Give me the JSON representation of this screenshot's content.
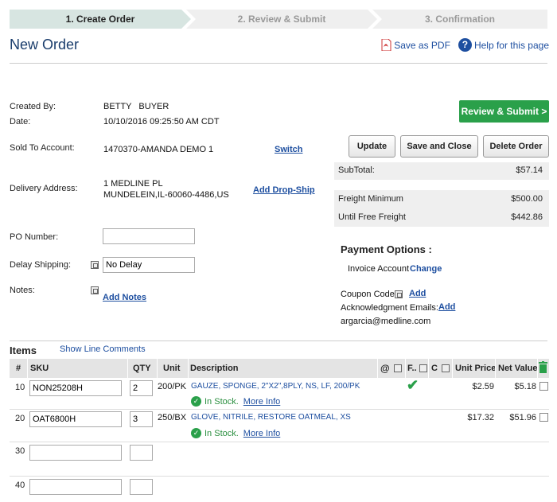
{
  "steps": [
    {
      "label": "1. Create Order"
    },
    {
      "label": "2. Review & Submit"
    },
    {
      "label": "3. Confirmation"
    }
  ],
  "page_title": "New Order",
  "top_links": {
    "save_pdf": "Save as PDF",
    "help": "Help for this page"
  },
  "order": {
    "created_by_label": "Created By:",
    "created_by": "BETTY   BUYER",
    "date_label": "Date:",
    "date": "10/10/2016 09:25:50 AM CDT",
    "sold_to_label": "Sold To Account:",
    "sold_to": "1470370-AMANDA DEMO 1",
    "switch_label": "Switch",
    "delivery_label": "Delivery Address:",
    "delivery_line1": "1 MEDLINE PL",
    "delivery_line2": "MUNDELEIN,IL-60060-4486,US",
    "add_dropship": "Add Drop-Ship",
    "po_label": "PO Number:",
    "po_value": "",
    "delay_label": "Delay Shipping:",
    "delay_value": "No Delay",
    "notes_label": "Notes:",
    "add_notes": "Add Notes"
  },
  "actions": {
    "review_submit": "Review & Submit >",
    "update": "Update",
    "save_close": "Save and Close",
    "delete": "Delete Order"
  },
  "summary": {
    "subtotal_label": "SubTotal:",
    "subtotal": "$57.14",
    "freight_min_label": "Freight Minimum",
    "freight_min": "$500.00",
    "free_freight_label": "Until Free Freight",
    "free_freight": "$442.86"
  },
  "payment": {
    "title": "Payment Options :",
    "method": "Invoice Account",
    "change": "Change",
    "coupon_label": "Coupon Code:",
    "coupon_add": "Add",
    "ack_label": "Acknowledgment Emails:",
    "ack_add": "Add",
    "email": "argarcia@medline.com"
  },
  "items": {
    "title": "Items",
    "show_comments": "Show Line Comments",
    "columns": {
      "num": "#",
      "sku": "SKU",
      "qty": "QTY",
      "unit": "Unit",
      "description": "Description",
      "at": "@",
      "f": "F..",
      "c": "C",
      "unit_price": "Unit Price",
      "net_value": "Net Value"
    },
    "rows": [
      {
        "num": "10",
        "sku": "NON25208H",
        "qty": "2",
        "unit": "200/PK",
        "description": "GAUZE, SPONGE, 2\"X2\",8PLY, NS, LF, 200/PK",
        "stock": "In Stock.",
        "more_info": "More Info",
        "unit_price": "$2.59",
        "net_value": "$5.18"
      },
      {
        "num": "20",
        "sku": "OAT6800H",
        "qty": "3",
        "unit": "250/BX",
        "description": "GLOVE, NITRILE, RESTORE OATMEAL, XS",
        "stock": "In Stock.",
        "more_info": "More Info",
        "unit_price": "$17.32",
        "net_value": "$51.96"
      },
      {
        "num": "30",
        "sku": "",
        "qty": ""
      },
      {
        "num": "40",
        "sku": "",
        "qty": ""
      }
    ]
  },
  "colors": {
    "primary_green": "#2aa04a",
    "link_blue": "#1e4fa0",
    "title_navy": "#1a3d6c"
  }
}
